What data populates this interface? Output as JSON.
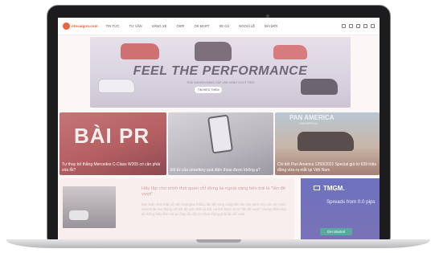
{
  "nav": {
    "logo": "otosaigon.com",
    "items": [
      "TIN TỨC",
      "TƯ VẤN",
      "HÃNG XE",
      "OSPI",
      "OS MART",
      "XE CŨ",
      "NGOÀI LỀ",
      "BÀI MỚI"
    ],
    "icons": [
      "moon-icon",
      "mail-icon",
      "bell-icon",
      "user-icon",
      "search-icon"
    ]
  },
  "banner": {
    "headline": "FEEL THE PERFORMANCE",
    "subline": "TRẢI NGHIỆM ĐẲNG CẤP VẬN HÀNH VƯỢT TRỘI",
    "button": "TÌM HIỂU THÊM"
  },
  "featured": [
    {
      "overlay": "BÀI PR",
      "title": "Tự thay bố thắng Mercedes C-Class W205 có cần phải xóa lỗi?"
    },
    {
      "overlay": "",
      "title": "Độ từ của smartkey quá điện thoại được không ạ?"
    },
    {
      "overlay": "PAN AMERICA",
      "overlay_sub": "1250 SPECIAL",
      "title": "Chi tiết Pan America 1250/2021 Special giá từ 639 triệu đồng vừa ra mắt tại Việt Nam"
    }
  ],
  "article": {
    "title": "Hãy tập cho mình thói quen chỉ dừng lại ngoài sáng bên trái là \"lấn để vượt\"",
    "body": "Bạn luôn nhớ chắc về vấn hoạt giao thông, lấn để trong cùng trên làn cho danh cho các xe muốn vượt hoặc lưu thông với tốc độ cao nhất và thể, và thể được sử là \"lấn để vượt\" nhưng nhiều bác tài thông hiểu lấm mà lại chạy tốc độ chỉ chưa thông phải lấn để vượt"
  },
  "ad": {
    "brand": "TMGM.",
    "text": "Spreads from 0.0 pips",
    "button": "Get Started"
  }
}
